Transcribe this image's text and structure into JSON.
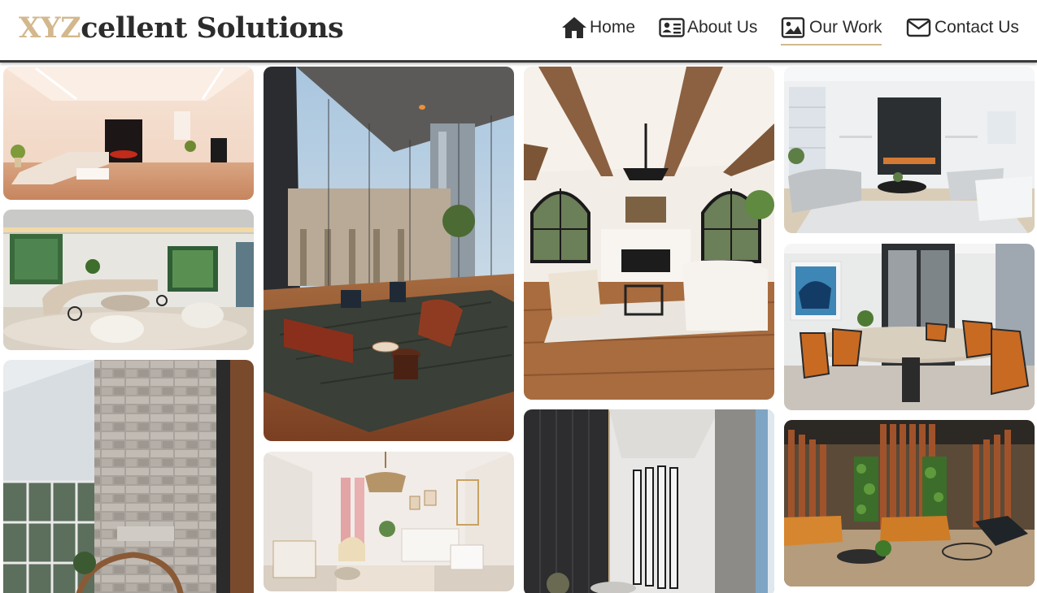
{
  "brand": {
    "accent": "XYZ",
    "rest": "cellent Solutions"
  },
  "nav": [
    {
      "label": "Home",
      "icon": "home-icon"
    },
    {
      "label": "About Us",
      "icon": "id-card-icon"
    },
    {
      "label": "Our Work",
      "icon": "image-icon",
      "active": true
    },
    {
      "label": "Contact Us",
      "icon": "envelope-icon"
    }
  ],
  "colors": {
    "accent": "#d3b88e",
    "text": "#2a2a2a",
    "header_border": "#3a3a3a"
  },
  "gallery": [
    {
      "name": "photo-living-room-red-car",
      "subject": "minimal living room with red sports car display"
    },
    {
      "name": "photo-lounge-curved-sofa",
      "subject": "lounge with curved sofa and green artwork"
    },
    {
      "name": "photo-stone-wall-exterior",
      "subject": "stacked stone feature wall with rattan chair"
    },
    {
      "name": "photo-glass-atrium-lobby",
      "subject": "glass atrium lobby with leather sofas"
    },
    {
      "name": "photo-nursery",
      "subject": "nursery with crib, chandelier and pink curtains"
    },
    {
      "name": "photo-beamed-living-room",
      "subject": "living room with wooden ceiling beams and arched windows"
    },
    {
      "name": "photo-dark-corridor",
      "subject": "dark corridor with vertical slat partition"
    },
    {
      "name": "photo-fireplace-living-room",
      "subject": "white living room with black marble fireplace"
    },
    {
      "name": "photo-meeting-room",
      "subject": "meeting room with oval table and orange chairs"
    },
    {
      "name": "photo-lounge-wood-slats",
      "subject": "lounge with wooden slat ceiling and orange sofas"
    }
  ]
}
